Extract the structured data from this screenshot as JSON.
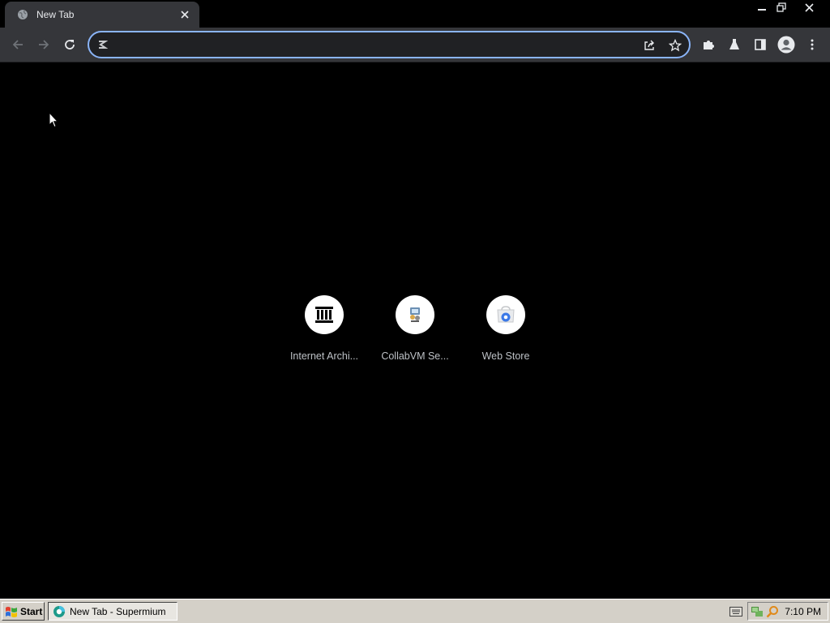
{
  "tabs": [
    {
      "title": "New Tab",
      "favicon": "globe-icon"
    }
  ],
  "window_controls": [
    "minimize-icon",
    "restore-icon",
    "close-icon"
  ],
  "toolbar": {
    "back_icon": "arrow-left-icon",
    "forward_icon": "arrow-right-icon",
    "reload_icon": "reload-icon",
    "omnibox": {
      "value": "",
      "placeholder": "",
      "icon": "supermium-icon"
    },
    "share_icon": "share-icon",
    "bookmark_icon": "star-icon",
    "extensions_icon": "puzzle-icon",
    "labs_icon": "flask-icon",
    "side_panel_icon": "side-panel-icon",
    "profile_icon": "profile-avatar-icon",
    "menu_icon": "kebab-menu-icon"
  },
  "shortcuts": [
    {
      "label": "Internet Archi...",
      "icon": "archive-building-icon"
    },
    {
      "label": "CollabVM Se...",
      "icon": "collabvm-icon"
    },
    {
      "label": "Web Store",
      "icon": "web-store-icon"
    }
  ],
  "taskbar": {
    "start_label": "Start",
    "tasks": [
      {
        "label": "New Tab - Supermium",
        "icon": "supermium-icon"
      }
    ],
    "clock": "7:10 PM"
  },
  "colors": {
    "accent": "#8ab4f8",
    "toolbar_bg": "#35363a",
    "page_bg": "#000000",
    "taskbar_bg": "#d4d0c8"
  }
}
